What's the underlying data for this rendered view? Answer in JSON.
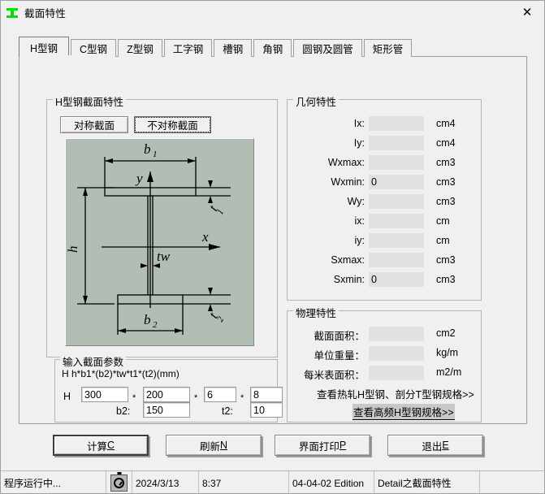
{
  "window": {
    "title": "截面特性",
    "icon": "i-beam-icon",
    "close_label": "✕"
  },
  "tabs": [
    {
      "label": "H型钢",
      "active": true
    },
    {
      "label": "C型钢",
      "active": false
    },
    {
      "label": "Z型钢",
      "active": false
    },
    {
      "label": "工字钢",
      "active": false
    },
    {
      "label": "槽钢",
      "active": false
    },
    {
      "label": "角钢",
      "active": false
    },
    {
      "label": "圆钢及圆管",
      "active": false
    },
    {
      "label": "矩形管",
      "active": false
    }
  ],
  "section_group": {
    "legend": "H型钢截面特性",
    "symmetric_label": "对称截面",
    "asymmetric_label": "不对称截面",
    "selected": "不对称截面"
  },
  "diagram": {
    "name": "asymmetric-h-section-diagram",
    "background_color": "#b2beb4",
    "labels": {
      "b1": "b₁",
      "b2": "b₂",
      "h": "h",
      "tw": "tw",
      "t1": "t₁",
      "t2": "t₂",
      "axis_x": "x",
      "axis_y": "y"
    }
  },
  "input_group": {
    "legend": "输入截面参数",
    "format_line": "H   h*b1*(b2)*tw*t1*(t2)(mm)",
    "row1_prefix": "H",
    "separator": "*",
    "fields": {
      "h": "300",
      "b1": "200",
      "tw": "6",
      "t1": "8",
      "b2": "150",
      "t2": "10"
    },
    "b2_label": "b2:",
    "t2_label": "t2:"
  },
  "geometry_group": {
    "legend": "几何特性",
    "rows": [
      {
        "label": "Ix:",
        "value": "",
        "unit": "cm4"
      },
      {
        "label": "Iy:",
        "value": "",
        "unit": "cm4"
      },
      {
        "label": "Wxmax:",
        "value": "",
        "unit": "cm3"
      },
      {
        "label": "Wxmin:",
        "value": "0",
        "unit": "cm3"
      },
      {
        "label": "Wy:",
        "value": "",
        "unit": "cm3"
      },
      {
        "label": "ix:",
        "value": "",
        "unit": "cm"
      },
      {
        "label": "iy:",
        "value": "",
        "unit": "cm"
      },
      {
        "label": "Sxmax:",
        "value": "",
        "unit": "cm3"
      },
      {
        "label": "Sxmin:",
        "value": "0",
        "unit": "cm3"
      }
    ]
  },
  "physics_group": {
    "legend": "物理特性",
    "rows": [
      {
        "label": "截面面积：",
        "value": "",
        "unit": "cm2"
      },
      {
        "label": "单位重量：",
        "value": "",
        "unit": "kg/m"
      },
      {
        "label": "每米表面积：",
        "value": "",
        "unit": "m2/m"
      }
    ],
    "link1": "查看热轧H型钢、剖分T型钢规格>>",
    "link2": "查看高频H型钢规格>>"
  },
  "buttons": {
    "calc": {
      "text": "计算",
      "accel": "C"
    },
    "refresh": {
      "text": "刷新",
      "accel": "N"
    },
    "print": {
      "text": "界面打印",
      "accel": "P"
    },
    "exit": {
      "text": "退出",
      "accel": "E"
    }
  },
  "statusbar": {
    "running": "程序运行中...",
    "clock_icon": "clock-icon",
    "date": "2024/3/13",
    "time": "8:37",
    "edition": "04-04-02 Edition",
    "detail": "Detail之截面特性",
    "empty": ""
  }
}
